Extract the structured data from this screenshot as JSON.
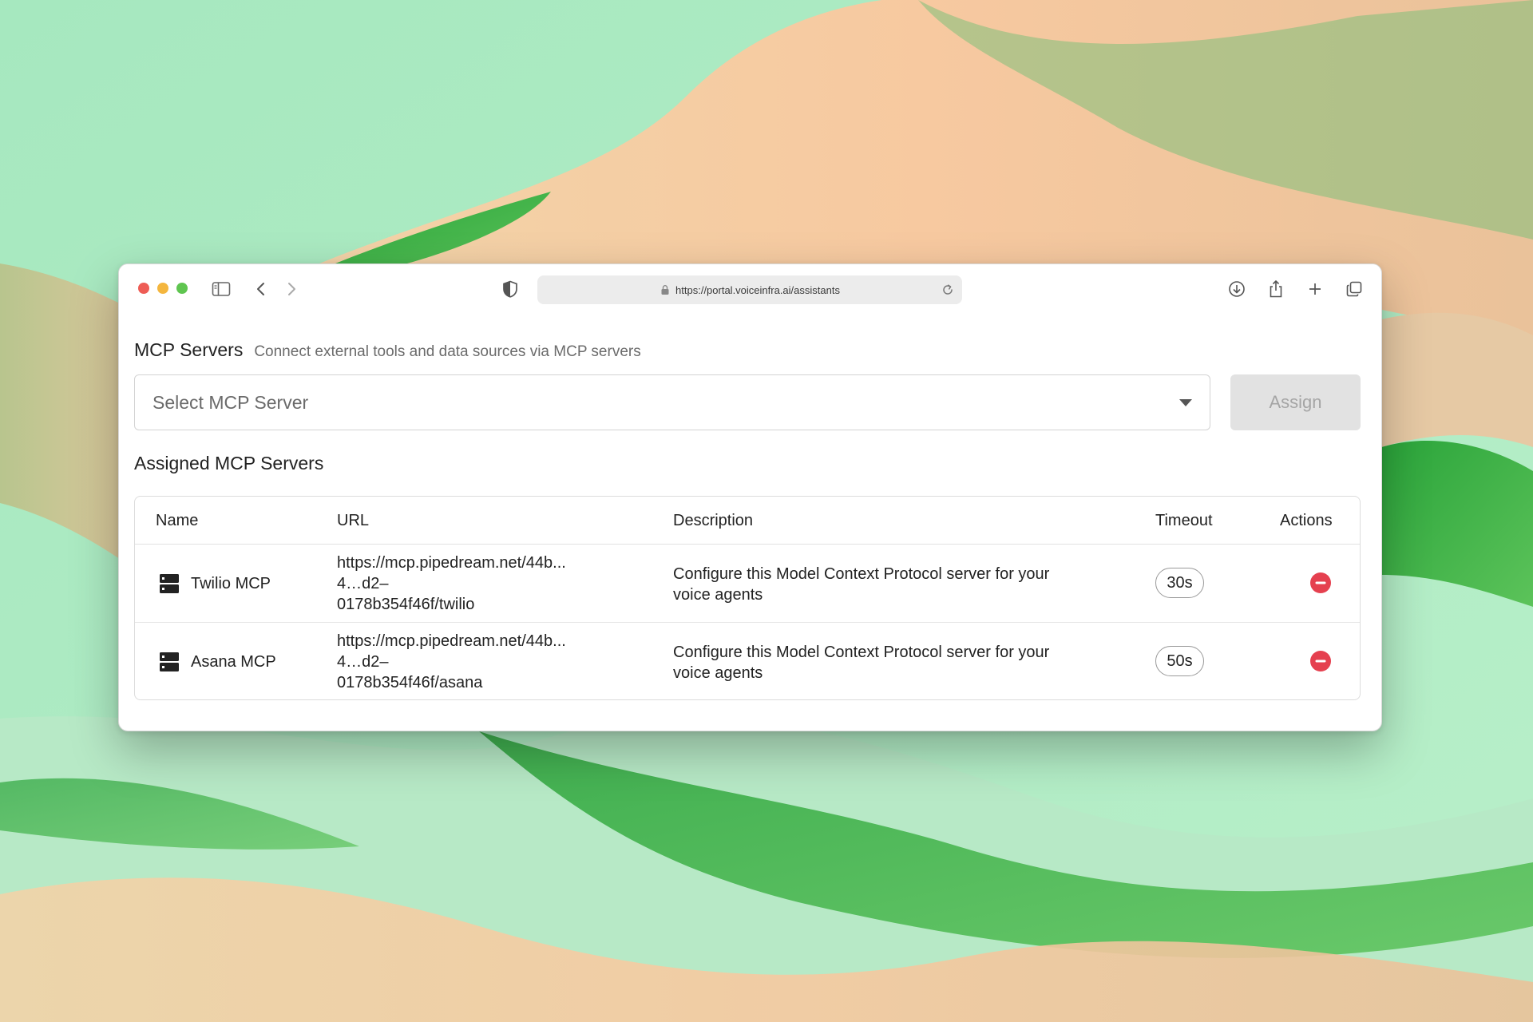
{
  "browser": {
    "url": "https://portal.voiceinfra.ai/assistants"
  },
  "mcp": {
    "title": "MCP Servers",
    "subtitle": "Connect external tools and data sources via MCP servers",
    "select_placeholder": "Select MCP Server",
    "assign_label": "Assign",
    "assigned_title": "Assigned MCP Servers"
  },
  "table": {
    "headers": {
      "name": "Name",
      "url": "URL",
      "description": "Description",
      "timeout": "Timeout",
      "actions": "Actions"
    },
    "rows": [
      {
        "name": "Twilio MCP",
        "url_line1": "https://mcp.pipedream.net/44b...",
        "url_line2": "4…d2–",
        "url_line3": "0178b354f46f/twilio",
        "description": "Configure this Model Context Protocol server for your voice agents",
        "timeout": "30s"
      },
      {
        "name": "Asana MCP",
        "url_line1": "https://mcp.pipedream.net/44b...",
        "url_line2": "4…d2–",
        "url_line3": "0178b354f46f/asana",
        "description": "Configure this Model Context Protocol server for your voice agents",
        "timeout": "50s"
      }
    ]
  },
  "colors": {
    "remove_action": "#e5404f",
    "assign_disabled_bg": "#e2e2e2"
  },
  "icons": {
    "server": "server-icon",
    "remove": "remove-circle-icon"
  }
}
